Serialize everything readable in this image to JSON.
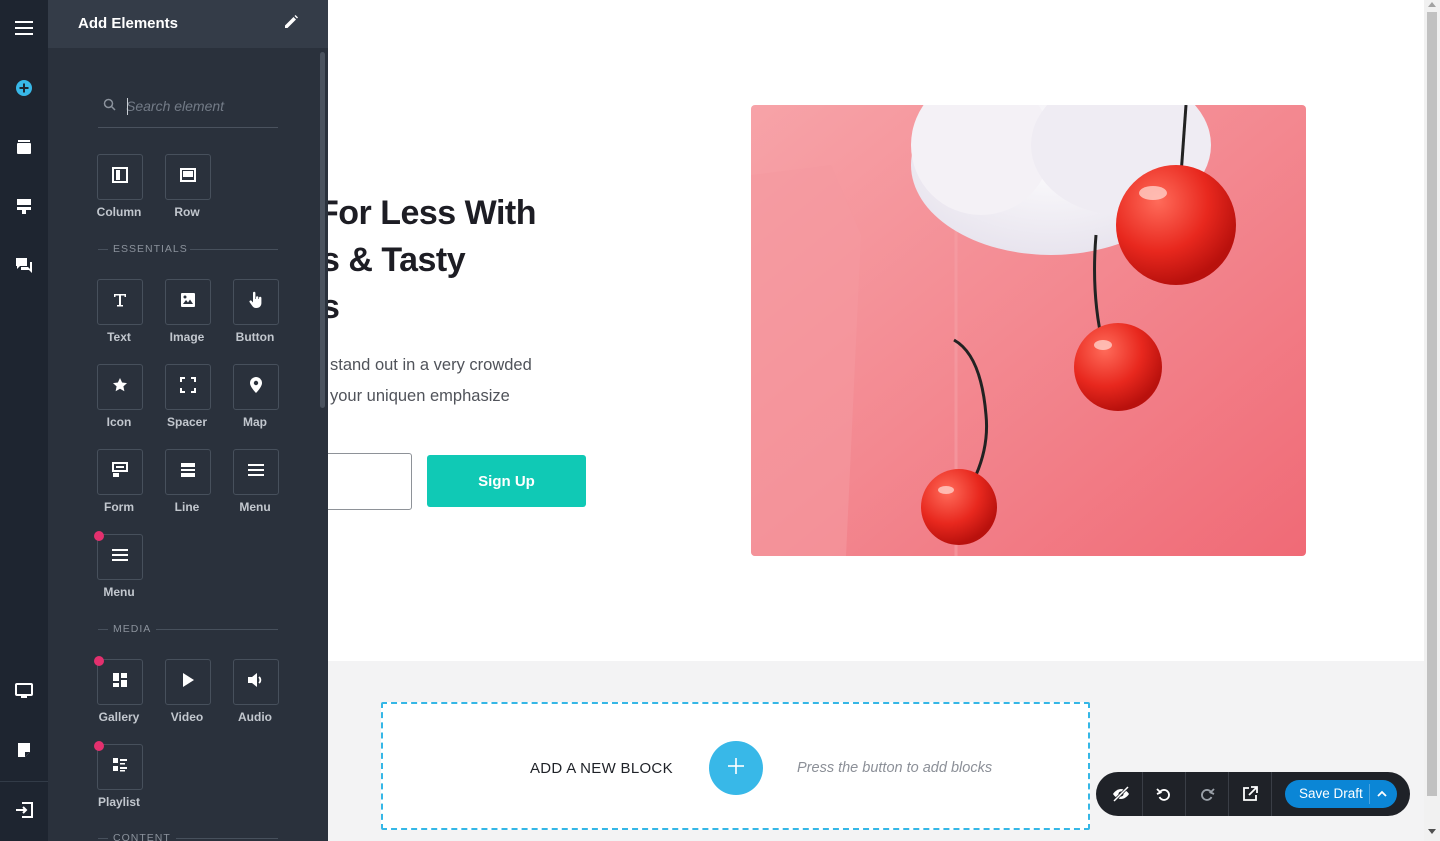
{
  "panel": {
    "title": "Add Elements",
    "search_placeholder": "Search element",
    "layout_items": [
      {
        "label": "Column",
        "icon": "column-icon"
      },
      {
        "label": "Row",
        "icon": "row-icon"
      }
    ],
    "sections": {
      "essentials": "ESSENTIALS",
      "media": "MEDIA",
      "content": "CONTENT"
    },
    "essentials_items": [
      {
        "label": "Text",
        "icon": "text-icon"
      },
      {
        "label": "Image",
        "icon": "image-icon"
      },
      {
        "label": "Button",
        "icon": "pointer-hand-icon"
      },
      {
        "label": "Icon",
        "icon": "star-icon"
      },
      {
        "label": "Spacer",
        "icon": "spacer-icon"
      },
      {
        "label": "Map",
        "icon": "map-pin-icon"
      },
      {
        "label": "Form",
        "icon": "form-icon"
      },
      {
        "label": "Line",
        "icon": "line-icon"
      },
      {
        "label": "Menu",
        "icon": "menu-icon"
      },
      {
        "label": "Menu",
        "icon": "menu-icon",
        "new": true
      }
    ],
    "media_items": [
      {
        "label": "Gallery",
        "icon": "gallery-icon",
        "new": true
      },
      {
        "label": "Video",
        "icon": "play-icon"
      },
      {
        "label": "Audio",
        "icon": "speaker-icon"
      },
      {
        "label": "Playlist",
        "icon": "playlist-icon",
        "new": true
      }
    ]
  },
  "canvas": {
    "hero_title_lines": [
      "For Less With",
      "s & Tasty",
      "s"
    ],
    "hero_subtitle_lines": [
      "stand out in a very crowded",
      "your uniquen emphasize"
    ],
    "signup_label": "Sign Up",
    "new_block_label": "ADD A NEW BLOCK",
    "new_block_hint": "Press the button to add blocks"
  },
  "toolbar": {
    "save_label": "Save Draft"
  },
  "colors": {
    "rail_bg": "#1e2530",
    "panel_bg": "#2a313c",
    "accent_teal": "#10c9b5",
    "accent_blue": "#38b8e8",
    "save_blue": "#0b86d6",
    "new_dot": "#e3306e"
  }
}
